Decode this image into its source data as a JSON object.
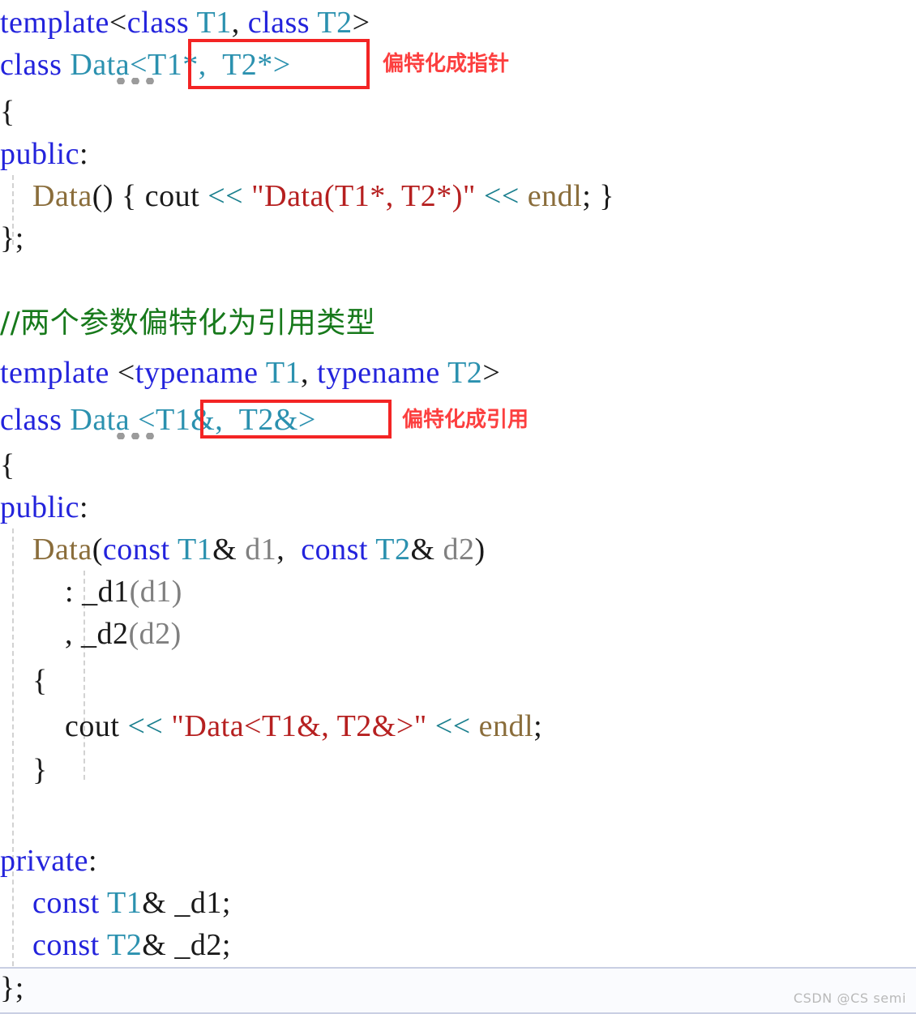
{
  "editor": {
    "language": "cpp",
    "background": "#ffffff",
    "colors": {
      "keyword": "#2323dc",
      "type": "#2b91af",
      "identifier": "#8a6d3b",
      "plain": "#1a1a1a",
      "parameter": "#808080",
      "string": "#b62020",
      "operator": "#1a7f8e",
      "comment": "#17791b",
      "annotation": "#fc3f3f",
      "annotation_box_border": "#f32424",
      "indent_guide": "#d2d2d2",
      "selected_line_background": "#fafbfe"
    }
  },
  "code": {
    "line1": {
      "kw1": "template",
      "lt": "<",
      "kw2": "class",
      "sp1": " ",
      "t1": "T1",
      "comma": ", ",
      "kw3": "class",
      "sp2": " ",
      "t2": "T2",
      "gt": ">"
    },
    "line2": {
      "kw": "class",
      "sp": " ",
      "name": "Data",
      "args": "<T1*,  T2*>"
    },
    "line3": {
      "brace": "{"
    },
    "line4": {
      "kw": "public",
      "colon": ":"
    },
    "line5": {
      "indent": "    ",
      "ctor": "Data",
      "paren": "() ",
      "open": "{ ",
      "cout": "cout",
      "sp1": " ",
      "op1": "<<",
      "sp2": " ",
      "str": "\"Data(T1*, T2*)\"",
      "sp3": " ",
      "op2": "<<",
      "sp4": " ",
      "endl": "endl",
      "semi": "; ",
      "close": "}"
    },
    "line6": {
      "text": "};"
    },
    "line7": {
      "comment": "//两个参数偏特化为引用类型"
    },
    "line8": {
      "kw1": "template",
      "sp0": " ",
      "lt": "<",
      "kw2": "typename",
      "sp1": " ",
      "t1": "T1",
      "comma": ", ",
      "kw3": "typename",
      "sp2": " ",
      "t2": "T2",
      "gt": ">"
    },
    "line9": {
      "kw": "class",
      "sp": " ",
      "name": "Data",
      "sp2": " ",
      "args": "<T1&,  T2&>"
    },
    "line10": {
      "brace": "{"
    },
    "line11": {
      "kw": "public",
      "colon": ":"
    },
    "line12": {
      "indent": "    ",
      "ctor": "Data",
      "op": "(",
      "kw1": "const",
      "sp1": " ",
      "t1": "T1",
      "amp1": "& ",
      "p1": "d1",
      "comma": ",  ",
      "kw2": "const",
      "sp2": " ",
      "t2": "T2",
      "amp2": "& ",
      "p2": "d2",
      "cp": ")"
    },
    "line13": {
      "indent": "        ",
      "colon": ": ",
      "member": "_d1",
      "arg": "(d1)"
    },
    "line14": {
      "indent": "        ",
      "comma": ", ",
      "member": "_d2",
      "arg": "(d2)"
    },
    "line15": {
      "indent": "    ",
      "brace": "{"
    },
    "line16": {
      "indent": "        ",
      "cout": "cout",
      "sp1": " ",
      "op1": "<<",
      "sp2": " ",
      "str": "\"Data<T1&, T2&>\"",
      "sp3": " ",
      "op2": "<<",
      "sp4": " ",
      "endl": "endl",
      "semi": ";"
    },
    "line17": {
      "indent": "    ",
      "brace": "}"
    },
    "line18": {
      "kw": "private",
      "colon": ":"
    },
    "line19": {
      "indent": "    ",
      "kw": "const",
      "sp1": " ",
      "type": "T1",
      "amp": "& ",
      "member": "_d1",
      "semi": ";"
    },
    "line20": {
      "indent": "    ",
      "kw": "const",
      "sp1": " ",
      "type": "T2",
      "amp": "& ",
      "member": "_d2",
      "semi": ";"
    },
    "line21": {
      "text": "};"
    }
  },
  "annotations": {
    "pointer": "偏特化成指针",
    "reference": "偏特化成引用"
  },
  "watermark": {
    "text": "CSDN @CS semi"
  }
}
